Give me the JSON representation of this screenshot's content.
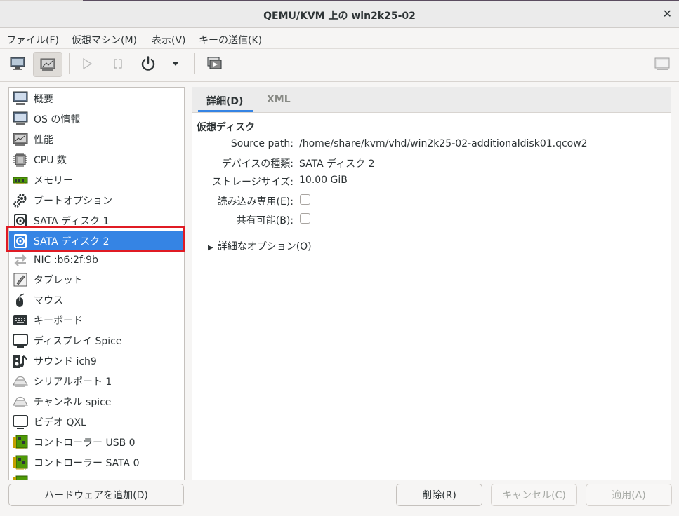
{
  "window": {
    "title": "QEMU/KVM 上の win2k25-02"
  },
  "menu": [
    "ファイル(F)",
    "仮想マシン(M)",
    "表示(V)",
    "キーの送信(K)"
  ],
  "hardware": [
    {
      "label": "概要",
      "icon": "monitor-icon"
    },
    {
      "label": "OS の情報",
      "icon": "monitor-icon"
    },
    {
      "label": "性能",
      "icon": "graph-icon"
    },
    {
      "label": "CPU 数",
      "icon": "cpu-icon"
    },
    {
      "label": "メモリー",
      "icon": "memory-icon"
    },
    {
      "label": "ブートオプション",
      "icon": "gears-icon"
    },
    {
      "label": "SATA ディスク 1",
      "icon": "disk-icon"
    },
    {
      "label": "SATA ディスク 2",
      "icon": "disk-icon",
      "selected": true
    },
    {
      "label": "NIC :b6:2f:9b",
      "icon": "network-icon"
    },
    {
      "label": "タブレット",
      "icon": "tablet-icon"
    },
    {
      "label": "マウス",
      "icon": "mouse-icon"
    },
    {
      "label": "キーボード",
      "icon": "keyboard-icon"
    },
    {
      "label": "ディスプレイ Spice",
      "icon": "display-icon"
    },
    {
      "label": "サウンド ich9",
      "icon": "sound-icon"
    },
    {
      "label": "シリアルポート 1",
      "icon": "serial-icon"
    },
    {
      "label": "チャンネル spice",
      "icon": "serial-icon"
    },
    {
      "label": "ビデオ QXL",
      "icon": "display-icon"
    },
    {
      "label": "コントローラー USB 0",
      "icon": "controller-icon"
    },
    {
      "label": "コントローラー SATA 0",
      "icon": "controller-icon"
    }
  ],
  "tabs": {
    "details": "詳細(D)",
    "xml": "XML"
  },
  "details": {
    "section_title": "仮想ディスク",
    "source_path_label": "Source path:",
    "source_path_value": "/home/share/kvm/vhd/win2k25-02-additionaldisk01.qcow2",
    "device_type_label": "デバイスの種類:",
    "device_type_value": "SATA ディスク 2",
    "storage_size_label": "ストレージサイズ:",
    "storage_size_value": "10.00 GiB",
    "readonly_label": "読み込み専用(E):",
    "readonly_checked": false,
    "shareable_label": "共有可能(B):",
    "shareable_checked": false,
    "advanced_label": "詳細なオプション(O)"
  },
  "buttons": {
    "add_hardware": "ハードウェアを追加(D)",
    "remove": "削除(R)",
    "cancel": "キャンセル(C)",
    "apply": "適用(A)"
  },
  "colors": {
    "selection": "#3584e4",
    "highlight_box": "#e01b24"
  }
}
